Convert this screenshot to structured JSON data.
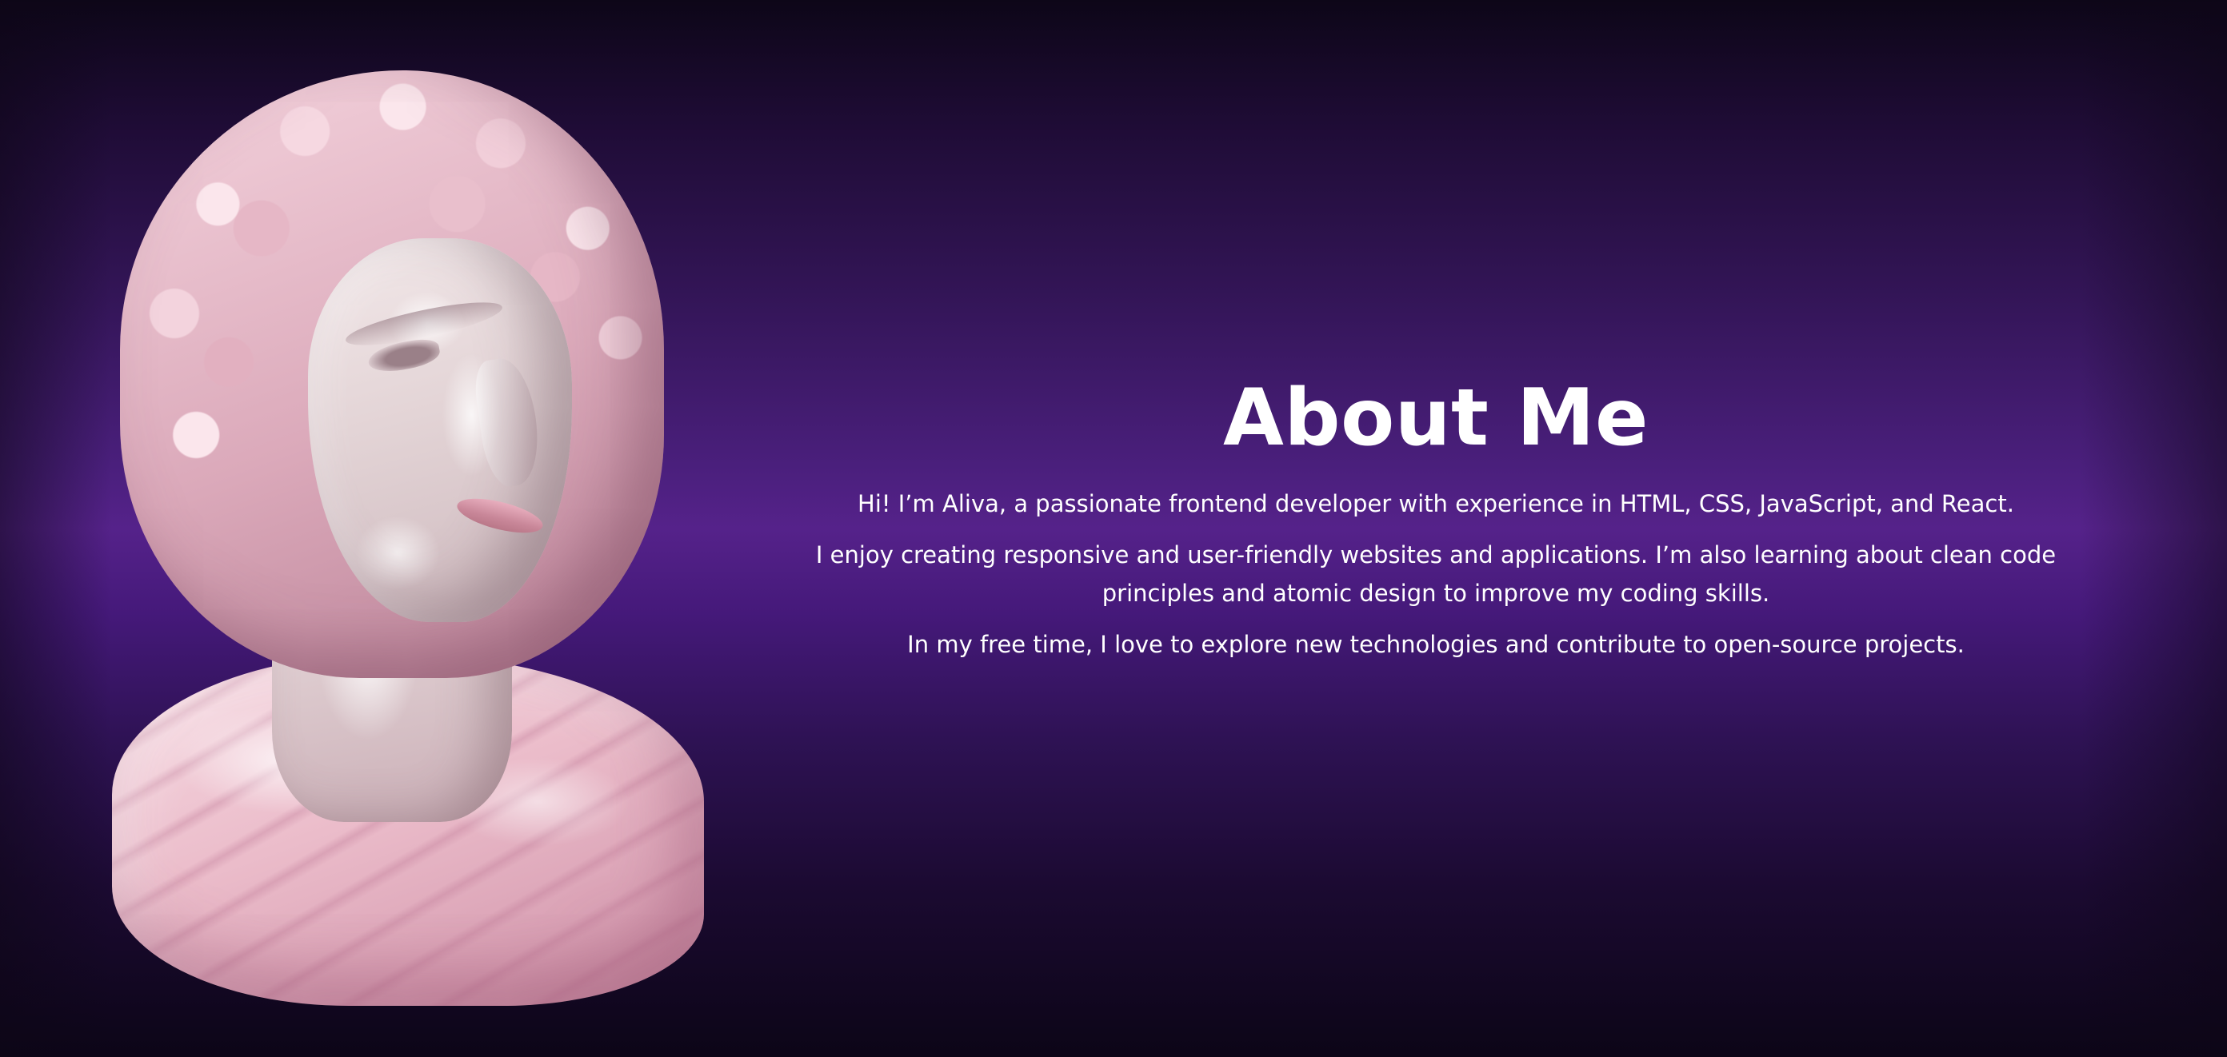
{
  "section": {
    "title": "About Me",
    "paragraphs": [
      "Hi! I’m Aliva, a passionate frontend developer with experience in HTML, CSS, JavaScript, and React.",
      "I enjoy creating responsive and user-friendly websites and applications. I’m also learning about clean code principles and atomic design to improve my coding skills.",
      "In my free time, I love to explore new technologies and contribute to open-source projects."
    ]
  },
  "image": {
    "subject": "pink-marble-bust-sculpture"
  },
  "colors": {
    "background_center": "#55228a",
    "background_edge": "#0d0618",
    "text": "#ffffff"
  }
}
